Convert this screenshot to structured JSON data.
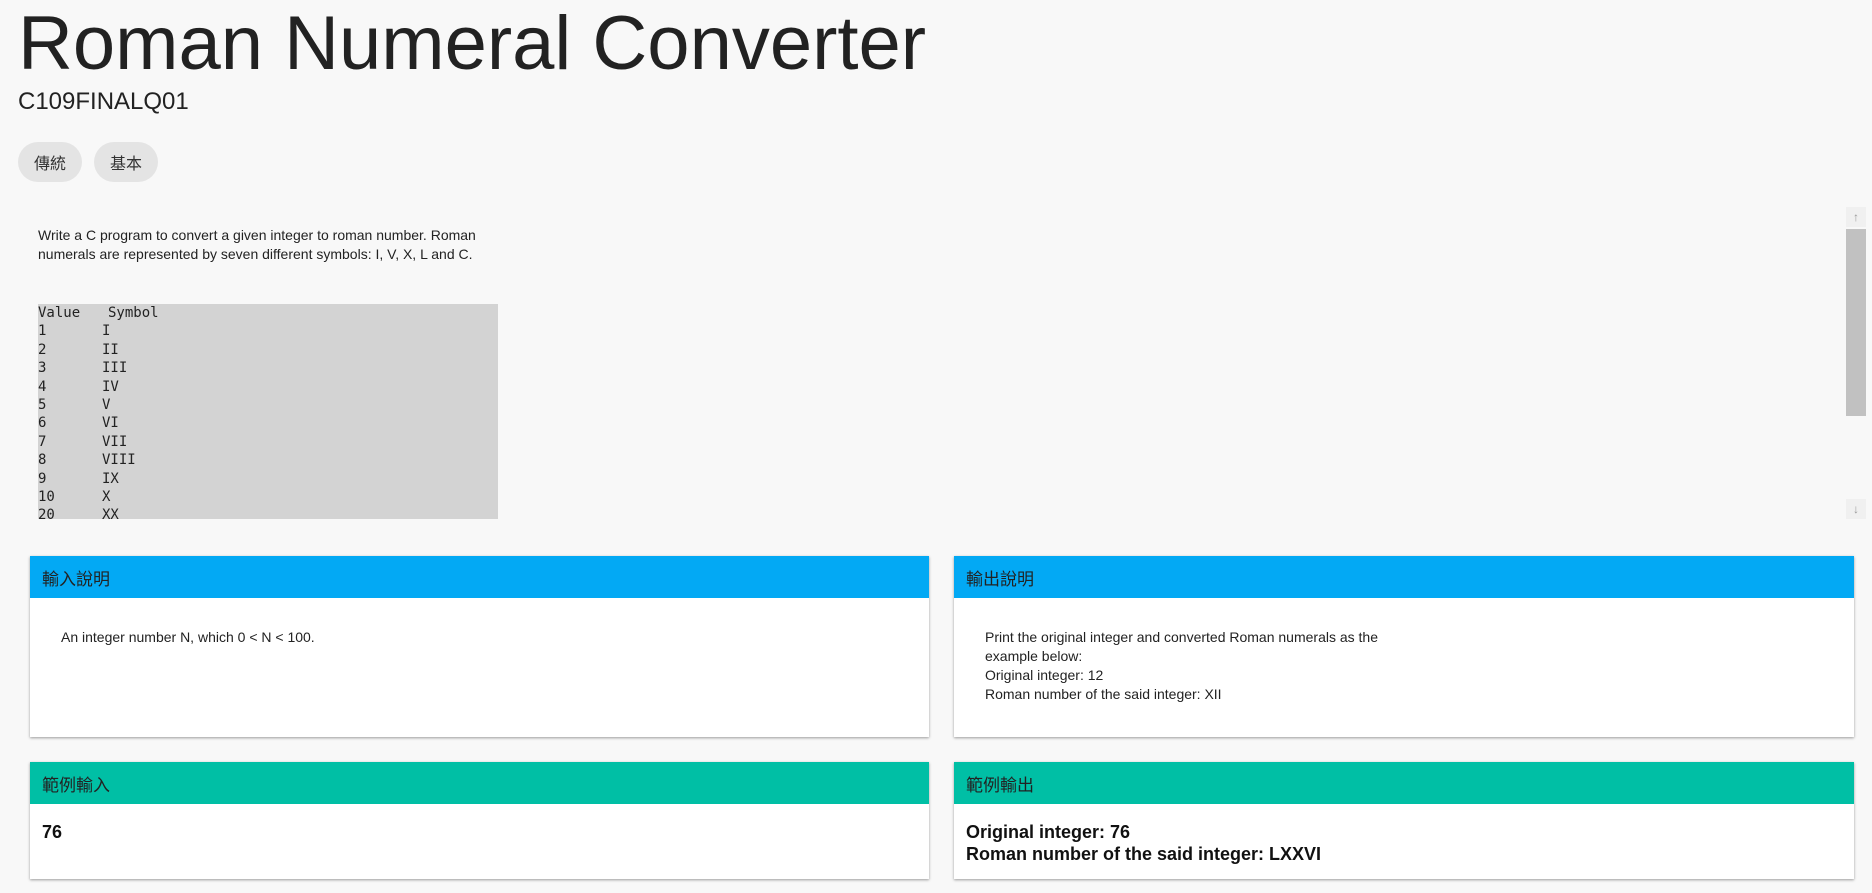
{
  "page": {
    "title": "Roman Numeral Converter",
    "subtitle": "C109FINALQ01",
    "chips": [
      "傳統",
      "基本"
    ]
  },
  "description": {
    "paragraph": "Write a C program to convert a given integer to roman number. Roman numerals are represented by seven different symbols: I, V, X, L and C.",
    "table_header": [
      "Value",
      "Symbol"
    ],
    "table_rows": [
      [
        "1",
        "I"
      ],
      [
        "2",
        "II"
      ],
      [
        "3",
        "III"
      ],
      [
        "4",
        "IV"
      ],
      [
        "5",
        "V"
      ],
      [
        "6",
        "VI"
      ],
      [
        "7",
        "VII"
      ],
      [
        "8",
        "VIII"
      ],
      [
        "9",
        "IX"
      ],
      [
        "10",
        "X"
      ],
      [
        "20",
        "XX"
      ]
    ]
  },
  "input_spec": {
    "heading": "輸入說明",
    "text": "An integer number N, which 0 < N < 100."
  },
  "output_spec": {
    "heading": "輸出說明",
    "line1": "Print the original integer and converted Roman numerals as the example below:",
    "line2": "Original integer: 12",
    "line3": "Roman number of the said integer: XII"
  },
  "sample_input": {
    "heading": "範例輸入",
    "text": "76"
  },
  "sample_output": {
    "heading": "範例輸出",
    "line1": "Original integer: 76",
    "line2": "Roman number of the said integer: LXXVI"
  },
  "colors": {
    "spec_header": "#03a9f4",
    "sample_header": "#00bfa5",
    "background": "#f8f8f8"
  }
}
